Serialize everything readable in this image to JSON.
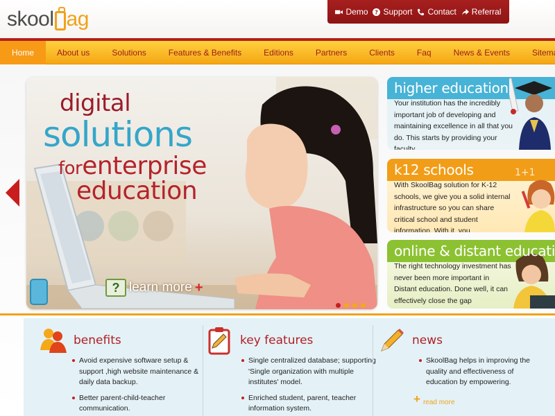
{
  "logo": {
    "part1": "skool",
    "part2": "ag"
  },
  "toplinks": [
    {
      "label": "Demo",
      "icon": "video-icon"
    },
    {
      "label": "Support",
      "icon": "question-icon"
    },
    {
      "label": "Contact",
      "icon": "phone-icon"
    },
    {
      "label": "Referral",
      "icon": "share-icon"
    }
  ],
  "nav": {
    "items": [
      "Home",
      "About us",
      "Solutions",
      "Features & Benefits",
      "Editions",
      "Partners",
      "Clients",
      "Faq",
      "News & Events",
      "Sitemap"
    ],
    "active": "Home"
  },
  "hero": {
    "line1": "digital",
    "line2": "solutions",
    "line3a": "for",
    "line3b": "enterprise",
    "line4": "education",
    "learn_more": "learn more",
    "learn_more_plus": "+"
  },
  "panels": {
    "higher": {
      "title": "higher education",
      "text": "Your institution has the incredibly important job of developing and maintaining excellence in all that you do. This starts by providing your faculty"
    },
    "k12": {
      "title": "k12 schools",
      "text": "With SkoolBag solution for K-12 schools, we give you a solid internal infrastructure so you can share critical school and student information. With it, you"
    },
    "online": {
      "title": "online & distant education",
      "text": "The right technology investment has never been more important in Distant education. Done well, it can effectively close the gap"
    }
  },
  "benefits": {
    "title": "benefits",
    "items": [
      "Avoid expensive software setup & support ,high website maintenance & daily data backup.",
      "Better parent-child-teacher communication."
    ]
  },
  "key_features": {
    "title": "key features",
    "items": [
      "Single centralized database; supporting 'Single organization with multiple institutes' model.",
      "Enriched student, parent, teacher information system."
    ]
  },
  "news": {
    "title": "news",
    "text": "SkoolBag helps in improving the quality and effectiveness of education by empowering.",
    "read_more": "read more",
    "read_more_plus": "+"
  },
  "colors": {
    "brand_red": "#b3201f",
    "brand_orange": "#f0a21a",
    "nav_yellow": "#ffd13f",
    "hero_blue": "#35a6c9",
    "panel_blue": "#47b3d6",
    "panel_orange": "#f29d18",
    "panel_green": "#8cc232"
  }
}
